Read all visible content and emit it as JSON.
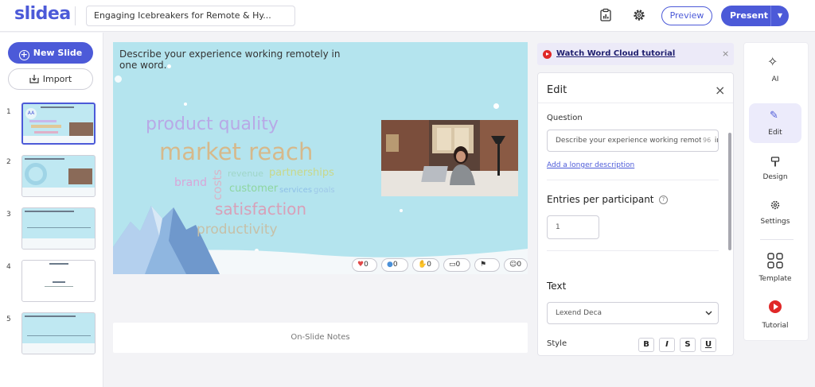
{
  "app": {
    "logo": "slidea",
    "presentation_title": "Engaging Icebreakers for Remote & Hy...",
    "brand_color": "#4c5ad8"
  },
  "toolbar": {
    "preview_label": "Preview",
    "present_label": "Present"
  },
  "left_sidebar": {
    "new_slide_label": "New Slide",
    "import_label": "Import",
    "slides": [
      {
        "number": "1"
      },
      {
        "number": "2"
      },
      {
        "number": "3"
      },
      {
        "number": "4"
      },
      {
        "number": "5"
      }
    ],
    "thumb1_avatar": "AA"
  },
  "slide": {
    "question": "Describe your experience working remotely in one word.",
    "words": [
      {
        "text": "product quality",
        "color": "#b8a9e6"
      },
      {
        "text": "market reach",
        "color": "#d6b98b"
      },
      {
        "text": "brand",
        "color": "#d8a6d8"
      },
      {
        "text": "costs",
        "color": "#d8b6c8"
      },
      {
        "text": "revenue",
        "color": "#9fd6c8"
      },
      {
        "text": "partnerships",
        "color": "#c8d88b"
      },
      {
        "text": "customer",
        "color": "#8ed6a0"
      },
      {
        "text": "services",
        "color": "#8fc0e8"
      },
      {
        "text": "goals",
        "color": "#9fc8e8"
      },
      {
        "text": "satisfaction",
        "color": "#d8a0b8"
      },
      {
        "text": "productivity",
        "color": "#c6c0a8"
      }
    ],
    "reactions": [
      {
        "icon": "heart-icon",
        "count": "0"
      },
      {
        "icon": "thumbs-up-icon",
        "count": "0"
      },
      {
        "icon": "clap-icon",
        "count": "0"
      },
      {
        "icon": "chat-icon",
        "count": "0"
      },
      {
        "icon": "flag-icon",
        "count": ""
      },
      {
        "icon": "user-icon",
        "count": "0"
      }
    ]
  },
  "notes": {
    "label": "On-Slide Notes"
  },
  "tutorial_banner": {
    "link": "Watch Word Cloud tutorial"
  },
  "edit_panel": {
    "title": "Edit",
    "question_label": "Question",
    "question_value": "Describe your experience working remotely in one word.",
    "question_count": "96",
    "longer_desc_link": "Add a longer description",
    "entries_label": "Entries per participant",
    "entries_value": "1",
    "text_label": "Text",
    "font_value": "Lexend Deca",
    "style_label": "Style",
    "style_buttons": [
      "B",
      "I",
      "S",
      "U"
    ]
  },
  "right_rail": {
    "items": [
      {
        "label": "AI",
        "icon": "sparkle-icon"
      },
      {
        "label": "Edit",
        "icon": "pen-icon"
      },
      {
        "label": "Design",
        "icon": "paint-roller-icon"
      },
      {
        "label": "Settings",
        "icon": "gear-icon"
      },
      {
        "label": "Template",
        "icon": "grid-icon"
      },
      {
        "label": "Tutorial",
        "icon": "play-icon"
      }
    ]
  }
}
